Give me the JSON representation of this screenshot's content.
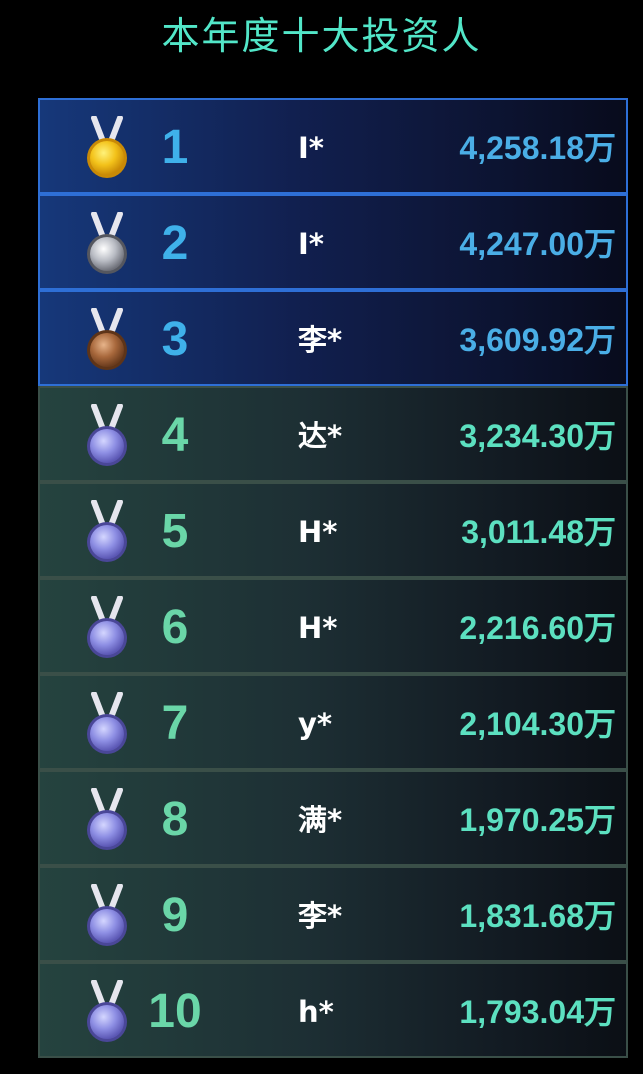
{
  "title": "本年度十大投资人",
  "unit": "万",
  "colors": {
    "title": "#52e6c8",
    "top_rank": "#3fb1ea",
    "other_rank": "#6ad6a8",
    "top_amount": "#4aaee6",
    "other_amount": "#5ce0c0"
  },
  "investors": [
    {
      "rank": "1",
      "name": "I*",
      "amount": "4,258.18万",
      "medal": "gold-medal-icon"
    },
    {
      "rank": "2",
      "name": "I*",
      "amount": "4,247.00万",
      "medal": "silver-medal-icon"
    },
    {
      "rank": "3",
      "name": "李*",
      "amount": "3,609.92万",
      "medal": "bronze-medal-icon"
    },
    {
      "rank": "4",
      "name": "达*",
      "amount": "3,234.30万",
      "medal": "purple-medal-icon"
    },
    {
      "rank": "5",
      "name": "H*",
      "amount": "3,011.48万",
      "medal": "purple-medal-icon"
    },
    {
      "rank": "6",
      "name": "H*",
      "amount": "2,216.60万",
      "medal": "purple-medal-icon"
    },
    {
      "rank": "7",
      "name": "y*",
      "amount": "2,104.30万",
      "medal": "purple-medal-icon"
    },
    {
      "rank": "8",
      "name": "满*",
      "amount": "1,970.25万",
      "medal": "purple-medal-icon"
    },
    {
      "rank": "9",
      "name": "李*",
      "amount": "1,831.68万",
      "medal": "purple-medal-icon"
    },
    {
      "rank": "10",
      "name": "h*",
      "amount": "1,793.04万",
      "medal": "purple-medal-icon"
    }
  ]
}
